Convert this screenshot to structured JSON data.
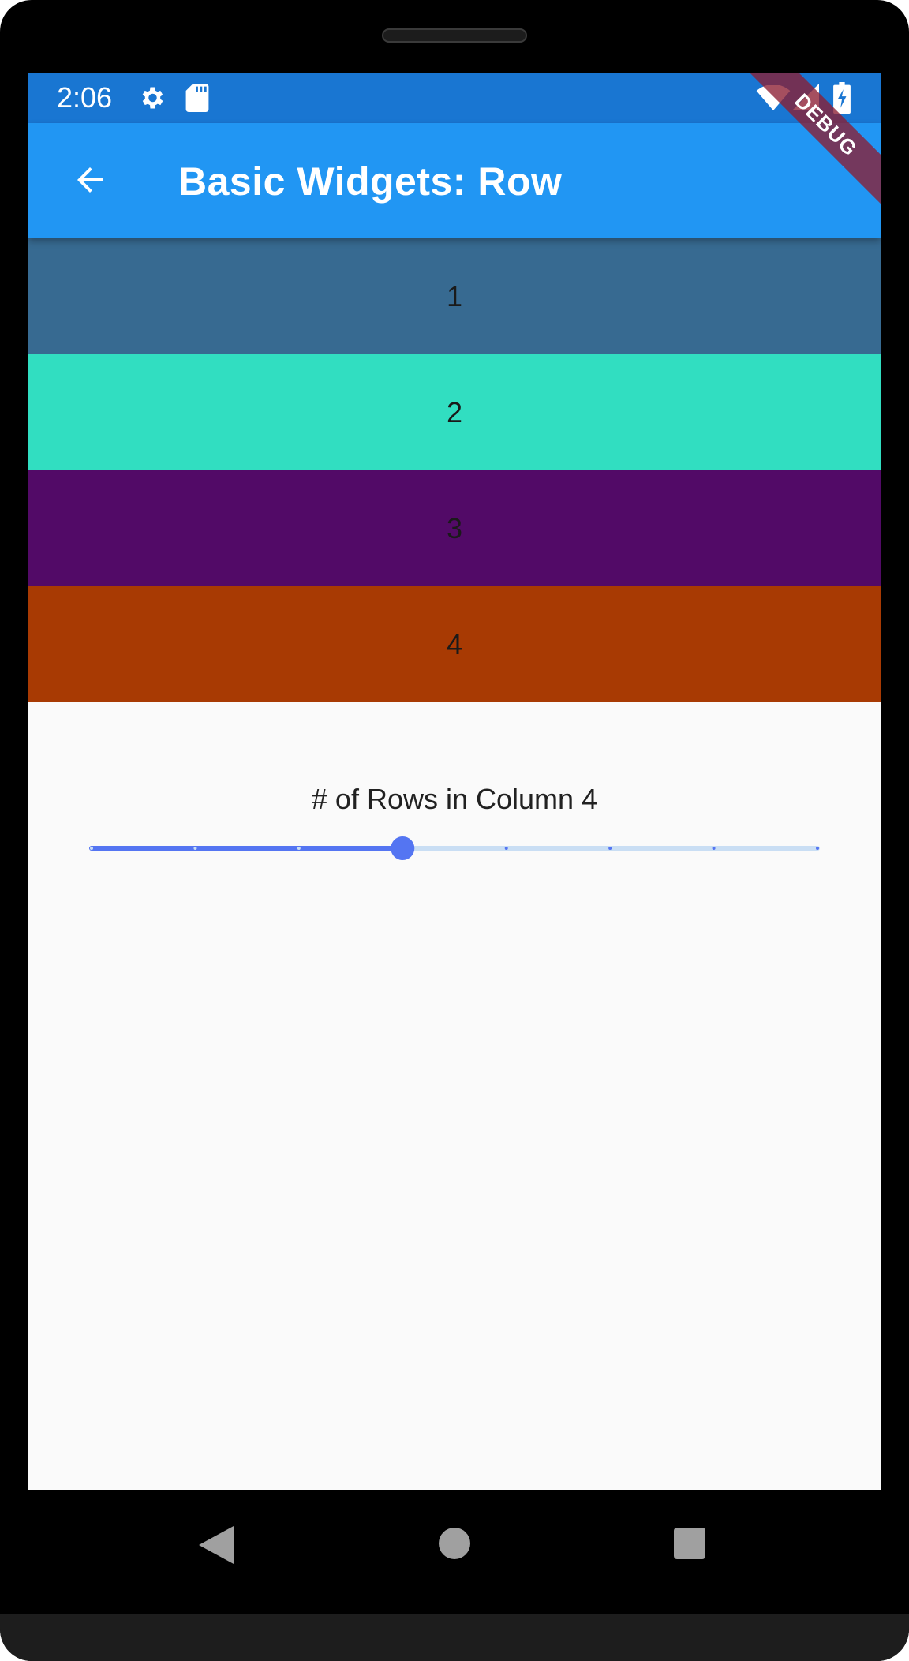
{
  "status_bar": {
    "time": "2:06",
    "left_icons": [
      "gear-icon",
      "sd-card-icon"
    ],
    "right_icons": [
      "wifi-icon",
      "signal-icon",
      "battery-charging-icon"
    ]
  },
  "app_bar": {
    "title": "Basic Widgets: Row",
    "back_icon": "arrow-back-icon",
    "debug_banner": "DEBUG",
    "color": "#2196f3"
  },
  "rows": [
    {
      "label": "1",
      "color": "#376a91"
    },
    {
      "label": "2",
      "color": "#31dec1"
    },
    {
      "label": "3",
      "color": "#520a67"
    },
    {
      "label": "4",
      "color": "#a83a03"
    }
  ],
  "slider": {
    "label": "# of Rows in Column 4",
    "min": 1,
    "max": 8,
    "divisions": 7,
    "value": 4,
    "active_color": "#5475f2",
    "inactive_color": "#c9def4"
  },
  "nav": {
    "icons": [
      "back-triangle-icon",
      "home-circle-icon",
      "recents-square-icon"
    ]
  }
}
